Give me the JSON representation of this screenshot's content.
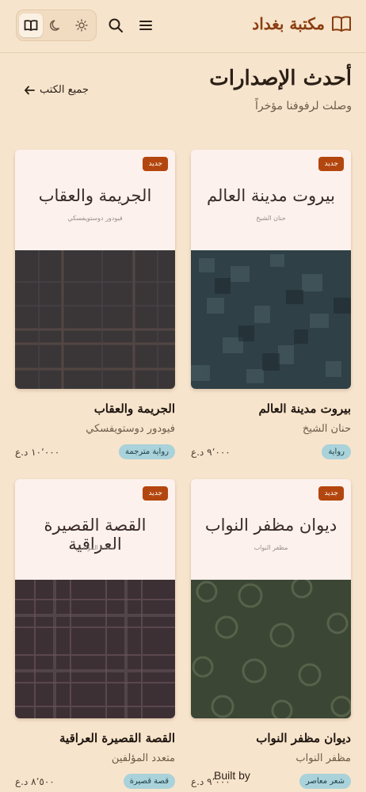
{
  "header": {
    "brand": "مكتبة بغداد",
    "theme_options": [
      "reader",
      "dark",
      "light"
    ],
    "icons": [
      "book-open-icon",
      "menu-icon",
      "search-icon",
      "moon-icon",
      "sun-icon"
    ]
  },
  "section": {
    "title": "أحدث الإصدارات",
    "subtitle": "وصلت لرفوفنا مؤخراً",
    "all_link": "جميع الكتب"
  },
  "books": [
    {
      "cover_title": "بيروت مدينة العالم",
      "cover_author": "حنان الشيخ",
      "badge": "جديد",
      "title": "بيروت مدينة العالم",
      "author": "حنان الشيخ",
      "genre": "رواية",
      "price": "٩٬٠٠٠ د.ع",
      "cover_color": "#2f4046"
    },
    {
      "cover_title": "الجريمة والعقاب",
      "cover_author": "فيودور دوستويفسكي",
      "badge": "جديد",
      "title": "الجريمة والعقاب",
      "author": "فيودور دوستويفسكي",
      "genre": "رواية مترجمة",
      "price": "١٠٬٠٠٠ د.ع",
      "cover_color": "#3a3638"
    },
    {
      "cover_title": "ديوان مظفر النواب",
      "cover_author": "مظفر النواب",
      "badge": "جديد",
      "title": "ديوان مظفر النواب",
      "author": "مظفر النواب",
      "genre": "شعر معاصر",
      "price": "٩٬٠٠٠ د.ع",
      "cover_color": "#3c4634"
    },
    {
      "cover_title": "القصة القصيرة العراقية",
      "cover_author": "متعدد المؤلفين",
      "badge": "جديد",
      "title": "القصة القصيرة العراقية",
      "author": "متعدد المؤلفين",
      "genre": "قصة قصيرة",
      "price": "٨٬٥٠٠ د.ع",
      "cover_color": "#3d3034"
    }
  ],
  "footer": {
    "built_by": "Built by"
  },
  "colors": {
    "accent": "#b3460e",
    "brand": "#8a3d10",
    "background": "#f7e4cc",
    "genre_badge": "#a9d2da"
  }
}
